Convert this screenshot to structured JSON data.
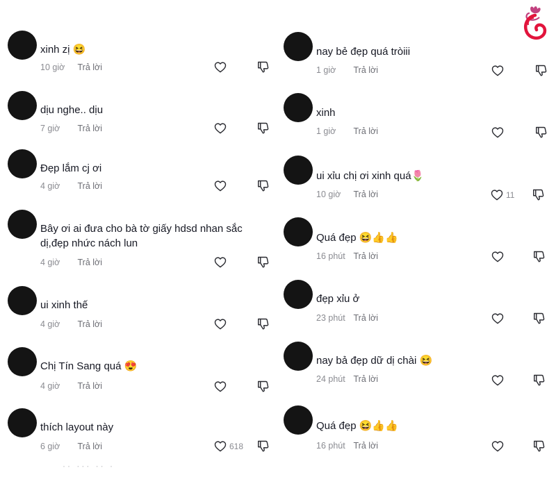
{
  "reply_label": "Trả lời",
  "colors": {
    "avatar": "#141414",
    "meta": "#8a8b91",
    "logo": "#e2143c"
  },
  "icons": {
    "like": "heart-outline-icon",
    "dislike": "thumbs-down-outline-icon",
    "logo": "lotus-face-logo"
  },
  "left_column": [
    {
      "text": "xinh zị 😆",
      "time": "10 giờ",
      "likes": ""
    },
    {
      "text": "dịu nghe.. dịu",
      "time": "7 giờ",
      "likes": ""
    },
    {
      "text": "Đẹp lắm cj ơi",
      "time": "4 giờ",
      "likes": ""
    },
    {
      "text": "Bây ơi ai đưa cho bà tờ giấy hdsd nhan sắc dị,đẹp nhức nách lun",
      "time": "4 giờ",
      "likes": ""
    },
    {
      "text": "ui xinh thế",
      "time": "4 giờ",
      "likes": ""
    },
    {
      "text": "Chị Tín Sang quá 😍",
      "time": "4 giờ",
      "likes": ""
    },
    {
      "text": "thích layout này",
      "time": "6 giờ",
      "likes": "618"
    }
  ],
  "right_column": [
    {
      "text": "nay bẻ đẹp quá tròiii",
      "time": "1 giờ",
      "likes": ""
    },
    {
      "text": "xinh",
      "time": "1 giờ",
      "likes": ""
    },
    {
      "text": "ui xỉu chị ơi xinh quá🌷",
      "time": "10 giờ",
      "likes": "11"
    },
    {
      "text": "Quá đẹp 😆👍👍",
      "time": "16 phút",
      "likes": ""
    },
    {
      "text": "đẹp xỉu ở",
      "time": "23 phút",
      "likes": ""
    },
    {
      "text": "nay bả đẹp dữ dị chài 😆",
      "time": "24 phút",
      "likes": ""
    },
    {
      "text": "Quá đẹp 😆👍👍",
      "time": "16 phút",
      "likes": ""
    }
  ]
}
